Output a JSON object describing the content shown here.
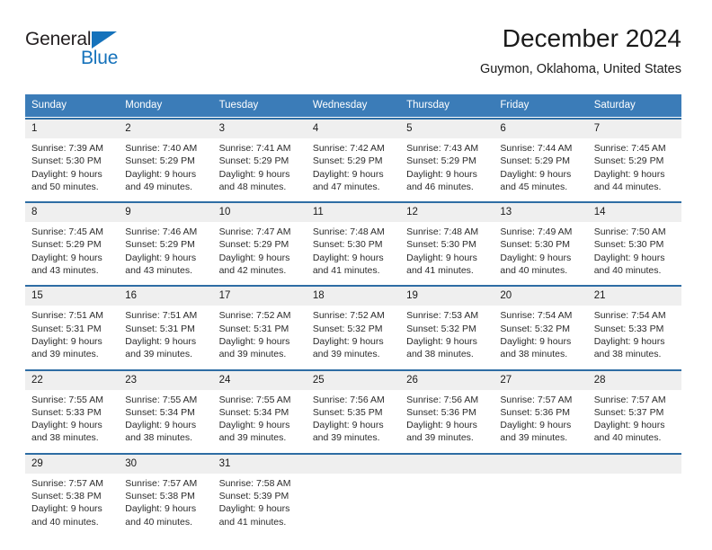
{
  "brand": {
    "name_part1": "General",
    "name_part2": "Blue",
    "triangle_color": "#1572bb"
  },
  "header": {
    "month_title": "December 2024",
    "location": "Guymon, Oklahoma, United States"
  },
  "colors": {
    "header_blue": "#3b7cb8",
    "row_rule_blue": "#2e6da4",
    "day_band_gray": "#efefef"
  },
  "calendar": {
    "weekdays": [
      "Sunday",
      "Monday",
      "Tuesday",
      "Wednesday",
      "Thursday",
      "Friday",
      "Saturday"
    ],
    "weeks": [
      [
        {
          "day": "1",
          "sunrise": "Sunrise: 7:39 AM",
          "sunset": "Sunset: 5:30 PM",
          "daylight_line1": "Daylight: 9 hours",
          "daylight_line2": "and 50 minutes."
        },
        {
          "day": "2",
          "sunrise": "Sunrise: 7:40 AM",
          "sunset": "Sunset: 5:29 PM",
          "daylight_line1": "Daylight: 9 hours",
          "daylight_line2": "and 49 minutes."
        },
        {
          "day": "3",
          "sunrise": "Sunrise: 7:41 AM",
          "sunset": "Sunset: 5:29 PM",
          "daylight_line1": "Daylight: 9 hours",
          "daylight_line2": "and 48 minutes."
        },
        {
          "day": "4",
          "sunrise": "Sunrise: 7:42 AM",
          "sunset": "Sunset: 5:29 PM",
          "daylight_line1": "Daylight: 9 hours",
          "daylight_line2": "and 47 minutes."
        },
        {
          "day": "5",
          "sunrise": "Sunrise: 7:43 AM",
          "sunset": "Sunset: 5:29 PM",
          "daylight_line1": "Daylight: 9 hours",
          "daylight_line2": "and 46 minutes."
        },
        {
          "day": "6",
          "sunrise": "Sunrise: 7:44 AM",
          "sunset": "Sunset: 5:29 PM",
          "daylight_line1": "Daylight: 9 hours",
          "daylight_line2": "and 45 minutes."
        },
        {
          "day": "7",
          "sunrise": "Sunrise: 7:45 AM",
          "sunset": "Sunset: 5:29 PM",
          "daylight_line1": "Daylight: 9 hours",
          "daylight_line2": "and 44 minutes."
        }
      ],
      [
        {
          "day": "8",
          "sunrise": "Sunrise: 7:45 AM",
          "sunset": "Sunset: 5:29 PM",
          "daylight_line1": "Daylight: 9 hours",
          "daylight_line2": "and 43 minutes."
        },
        {
          "day": "9",
          "sunrise": "Sunrise: 7:46 AM",
          "sunset": "Sunset: 5:29 PM",
          "daylight_line1": "Daylight: 9 hours",
          "daylight_line2": "and 43 minutes."
        },
        {
          "day": "10",
          "sunrise": "Sunrise: 7:47 AM",
          "sunset": "Sunset: 5:29 PM",
          "daylight_line1": "Daylight: 9 hours",
          "daylight_line2": "and 42 minutes."
        },
        {
          "day": "11",
          "sunrise": "Sunrise: 7:48 AM",
          "sunset": "Sunset: 5:30 PM",
          "daylight_line1": "Daylight: 9 hours",
          "daylight_line2": "and 41 minutes."
        },
        {
          "day": "12",
          "sunrise": "Sunrise: 7:48 AM",
          "sunset": "Sunset: 5:30 PM",
          "daylight_line1": "Daylight: 9 hours",
          "daylight_line2": "and 41 minutes."
        },
        {
          "day": "13",
          "sunrise": "Sunrise: 7:49 AM",
          "sunset": "Sunset: 5:30 PM",
          "daylight_line1": "Daylight: 9 hours",
          "daylight_line2": "and 40 minutes."
        },
        {
          "day": "14",
          "sunrise": "Sunrise: 7:50 AM",
          "sunset": "Sunset: 5:30 PM",
          "daylight_line1": "Daylight: 9 hours",
          "daylight_line2": "and 40 minutes."
        }
      ],
      [
        {
          "day": "15",
          "sunrise": "Sunrise: 7:51 AM",
          "sunset": "Sunset: 5:31 PM",
          "daylight_line1": "Daylight: 9 hours",
          "daylight_line2": "and 39 minutes."
        },
        {
          "day": "16",
          "sunrise": "Sunrise: 7:51 AM",
          "sunset": "Sunset: 5:31 PM",
          "daylight_line1": "Daylight: 9 hours",
          "daylight_line2": "and 39 minutes."
        },
        {
          "day": "17",
          "sunrise": "Sunrise: 7:52 AM",
          "sunset": "Sunset: 5:31 PM",
          "daylight_line1": "Daylight: 9 hours",
          "daylight_line2": "and 39 minutes."
        },
        {
          "day": "18",
          "sunrise": "Sunrise: 7:52 AM",
          "sunset": "Sunset: 5:32 PM",
          "daylight_line1": "Daylight: 9 hours",
          "daylight_line2": "and 39 minutes."
        },
        {
          "day": "19",
          "sunrise": "Sunrise: 7:53 AM",
          "sunset": "Sunset: 5:32 PM",
          "daylight_line1": "Daylight: 9 hours",
          "daylight_line2": "and 38 minutes."
        },
        {
          "day": "20",
          "sunrise": "Sunrise: 7:54 AM",
          "sunset": "Sunset: 5:32 PM",
          "daylight_line1": "Daylight: 9 hours",
          "daylight_line2": "and 38 minutes."
        },
        {
          "day": "21",
          "sunrise": "Sunrise: 7:54 AM",
          "sunset": "Sunset: 5:33 PM",
          "daylight_line1": "Daylight: 9 hours",
          "daylight_line2": "and 38 minutes."
        }
      ],
      [
        {
          "day": "22",
          "sunrise": "Sunrise: 7:55 AM",
          "sunset": "Sunset: 5:33 PM",
          "daylight_line1": "Daylight: 9 hours",
          "daylight_line2": "and 38 minutes."
        },
        {
          "day": "23",
          "sunrise": "Sunrise: 7:55 AM",
          "sunset": "Sunset: 5:34 PM",
          "daylight_line1": "Daylight: 9 hours",
          "daylight_line2": "and 38 minutes."
        },
        {
          "day": "24",
          "sunrise": "Sunrise: 7:55 AM",
          "sunset": "Sunset: 5:34 PM",
          "daylight_line1": "Daylight: 9 hours",
          "daylight_line2": "and 39 minutes."
        },
        {
          "day": "25",
          "sunrise": "Sunrise: 7:56 AM",
          "sunset": "Sunset: 5:35 PM",
          "daylight_line1": "Daylight: 9 hours",
          "daylight_line2": "and 39 minutes."
        },
        {
          "day": "26",
          "sunrise": "Sunrise: 7:56 AM",
          "sunset": "Sunset: 5:36 PM",
          "daylight_line1": "Daylight: 9 hours",
          "daylight_line2": "and 39 minutes."
        },
        {
          "day": "27",
          "sunrise": "Sunrise: 7:57 AM",
          "sunset": "Sunset: 5:36 PM",
          "daylight_line1": "Daylight: 9 hours",
          "daylight_line2": "and 39 minutes."
        },
        {
          "day": "28",
          "sunrise": "Sunrise: 7:57 AM",
          "sunset": "Sunset: 5:37 PM",
          "daylight_line1": "Daylight: 9 hours",
          "daylight_line2": "and 40 minutes."
        }
      ],
      [
        {
          "day": "29",
          "sunrise": "Sunrise: 7:57 AM",
          "sunset": "Sunset: 5:38 PM",
          "daylight_line1": "Daylight: 9 hours",
          "daylight_line2": "and 40 minutes."
        },
        {
          "day": "30",
          "sunrise": "Sunrise: 7:57 AM",
          "sunset": "Sunset: 5:38 PM",
          "daylight_line1": "Daylight: 9 hours",
          "daylight_line2": "and 40 minutes."
        },
        {
          "day": "31",
          "sunrise": "Sunrise: 7:58 AM",
          "sunset": "Sunset: 5:39 PM",
          "daylight_line1": "Daylight: 9 hours",
          "daylight_line2": "and 41 minutes."
        },
        {
          "day": "",
          "sunrise": "",
          "sunset": "",
          "daylight_line1": "",
          "daylight_line2": ""
        },
        {
          "day": "",
          "sunrise": "",
          "sunset": "",
          "daylight_line1": "",
          "daylight_line2": ""
        },
        {
          "day": "",
          "sunrise": "",
          "sunset": "",
          "daylight_line1": "",
          "daylight_line2": ""
        },
        {
          "day": "",
          "sunrise": "",
          "sunset": "",
          "daylight_line1": "",
          "daylight_line2": ""
        }
      ]
    ]
  }
}
